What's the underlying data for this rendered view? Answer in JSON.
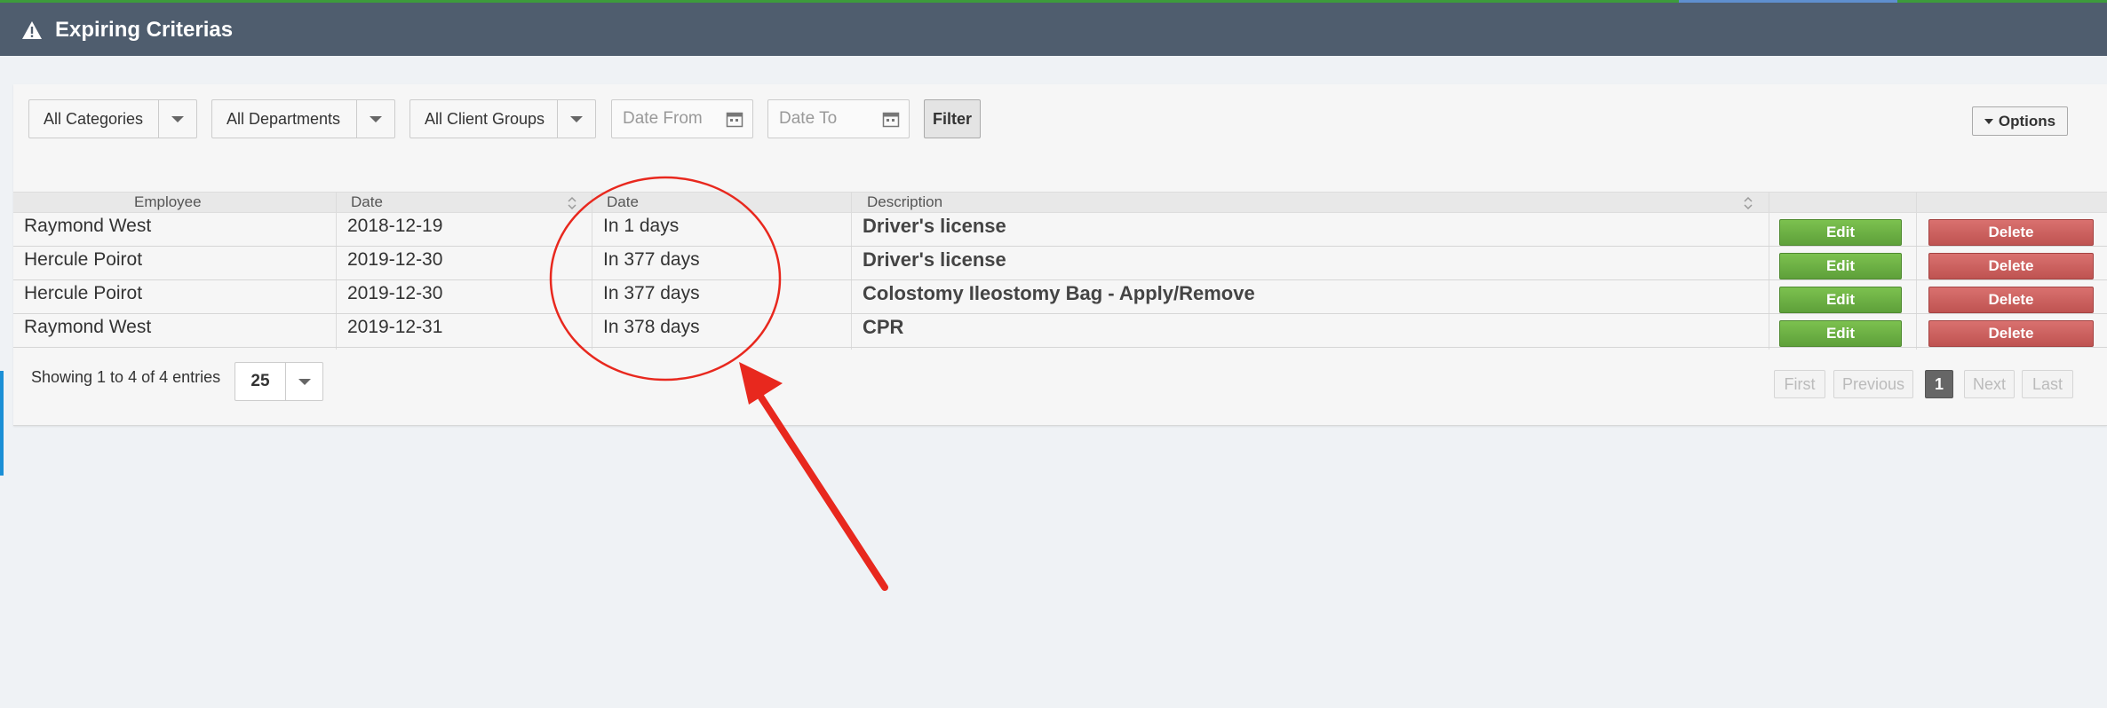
{
  "header": {
    "title": "Expiring Criterias",
    "icon": "warning-icon"
  },
  "filters": {
    "categories": "All Categories",
    "departments": "All Departments",
    "client_groups": "All Client Groups",
    "date_from_placeholder": "Date From",
    "date_to_placeholder": "Date To",
    "filter_label": "Filter",
    "options_label": "Options"
  },
  "table": {
    "headers": {
      "employee": "Employee",
      "date": "Date",
      "date2": "Date",
      "description": "Description"
    },
    "rows": [
      {
        "employee": "Raymond West",
        "date": "2018-12-19",
        "expires_in": "In 1 days",
        "description": "Driver's license",
        "edit": "Edit",
        "delete": "Delete"
      },
      {
        "employee": "Hercule Poirot",
        "date": "2019-12-30",
        "expires_in": "In 377 days",
        "description": "Driver's license",
        "edit": "Edit",
        "delete": "Delete"
      },
      {
        "employee": "Hercule Poirot",
        "date": "2019-12-30",
        "expires_in": "In 377 days",
        "description": "Colostomy Ileostomy Bag - Apply/Remove",
        "edit": "Edit",
        "delete": "Delete"
      },
      {
        "employee": "Raymond West",
        "date": "2019-12-31",
        "expires_in": "In 378 days",
        "description": "CPR",
        "edit": "Edit",
        "delete": "Delete"
      }
    ]
  },
  "footer": {
    "info": "Showing 1 to 4 of 4 entries",
    "page_size": "25",
    "pagination": {
      "first": "First",
      "previous": "Previous",
      "current": "1",
      "next": "Next",
      "last": "Last"
    }
  },
  "colors": {
    "header_bg": "#4f5d6e",
    "edit_green": "#6ab045",
    "delete_red": "#cc5f5d",
    "annotation_red": "#e8281e"
  }
}
